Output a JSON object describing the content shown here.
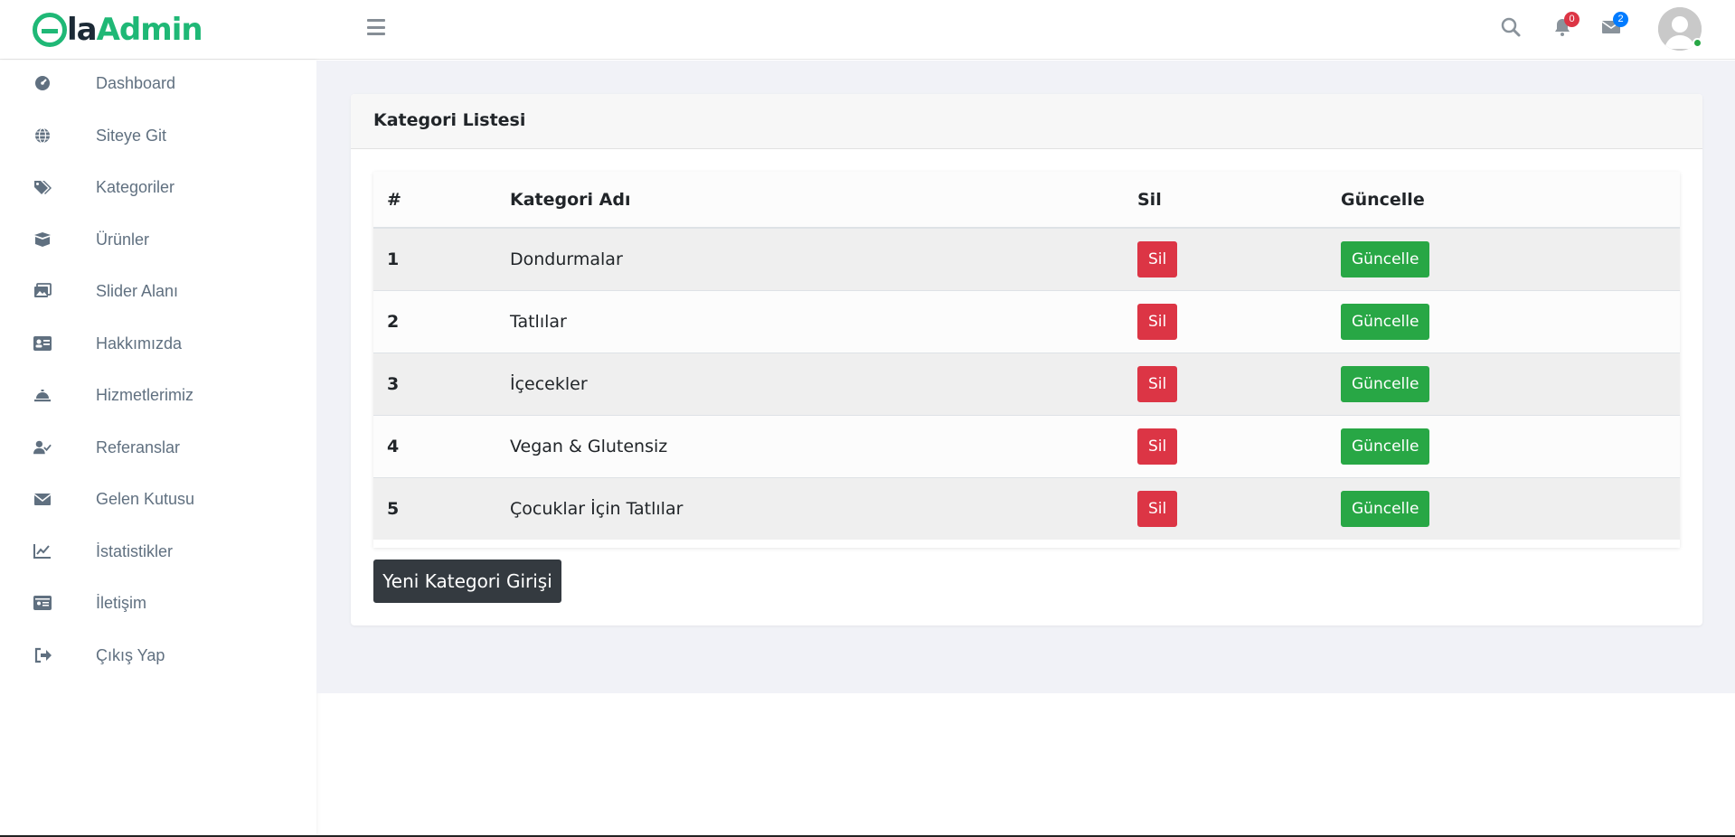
{
  "header": {
    "logo_letter": "e",
    "logo_la": "la",
    "logo_admin": "Admin",
    "notifications_count": "0",
    "messages_count": "2"
  },
  "sidebar": {
    "items": [
      {
        "label": "Dashboard",
        "icon": "dashboard-icon"
      },
      {
        "label": "Siteye Git",
        "icon": "globe-icon"
      },
      {
        "label": "Kategoriler",
        "icon": "tags-icon"
      },
      {
        "label": "Ürünler",
        "icon": "box-icon"
      },
      {
        "label": "Slider Alanı",
        "icon": "images-icon"
      },
      {
        "label": "Hakkımızda",
        "icon": "id-card-icon"
      },
      {
        "label": "Hizmetlerimiz",
        "icon": "bell-service-icon"
      },
      {
        "label": "Referanslar",
        "icon": "user-check-icon"
      },
      {
        "label": "Gelen Kutusu",
        "icon": "envelope-icon"
      },
      {
        "label": "İstatistikler",
        "icon": "chart-line-icon"
      },
      {
        "label": "İletişim",
        "icon": "address-card-icon"
      },
      {
        "label": "Çıkış Yap",
        "icon": "sign-out-icon"
      }
    ]
  },
  "card": {
    "title": "Kategori Listesi",
    "columns": [
      "#",
      "Kategori Adı",
      "Sil",
      "Güncelle"
    ],
    "rows": [
      {
        "id": "1",
        "name": "Dondurmalar",
        "delete": "Sil",
        "update": "Güncelle"
      },
      {
        "id": "2",
        "name": "Tatlılar",
        "delete": "Sil",
        "update": "Güncelle"
      },
      {
        "id": "3",
        "name": "İçecekler",
        "delete": "Sil",
        "update": "Güncelle"
      },
      {
        "id": "4",
        "name": "Vegan & Glutensiz",
        "delete": "Sil",
        "update": "Güncelle"
      },
      {
        "id": "5",
        "name": "Çocuklar İçin Tatlılar",
        "delete": "Sil",
        "update": "Güncelle"
      }
    ],
    "new_button": "Yeni Kategori Girişi"
  },
  "colors": {
    "brand": "#1fb876",
    "danger": "#dc3545",
    "success": "#28a745",
    "dark": "#343a40",
    "content_bg": "#f1f2f7"
  }
}
